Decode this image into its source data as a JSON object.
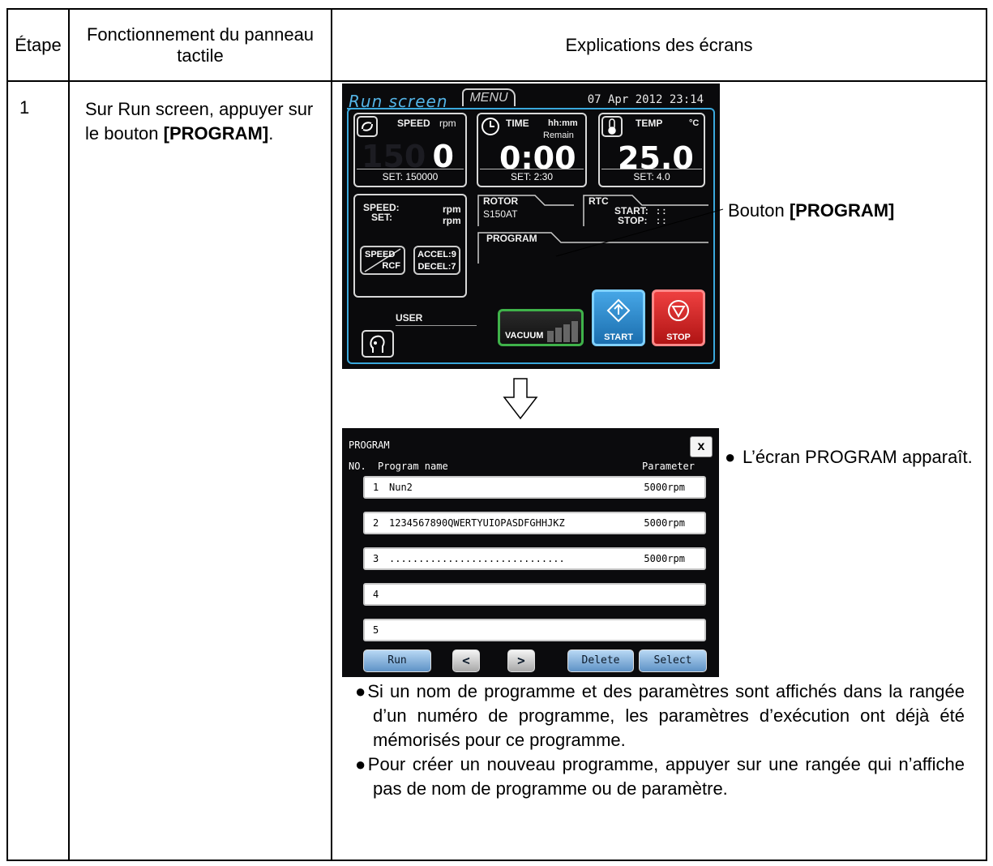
{
  "table": {
    "col_step": "Étape",
    "col_operation": "Fonctionnement du panneau tactile",
    "col_explanation": "Explications des écrans"
  },
  "row": {
    "step": "1",
    "operation_prefix": "Sur Run screen, appuyer sur le bouton ",
    "operation_button": "[PROGRAM]",
    "operation_suffix": "."
  },
  "run_screen": {
    "title": "Run screen",
    "menu_tab": "MENU",
    "datetime": "07 Apr 2012 23:14",
    "speed": {
      "label": "SPEED",
      "unit": "rpm",
      "value": "0",
      "set_label": "SET:",
      "set_value": "150000",
      "ghost_value": "150"
    },
    "time": {
      "label": "TIME",
      "unit": "hh:mm",
      "sub": "Remain",
      "value": "0:00",
      "set_label": "SET:",
      "set_value": "2:30"
    },
    "temp": {
      "label": "TEMP",
      "unit": "°C",
      "value": "25.0",
      "set_label": "SET:",
      "set_value": "4.0"
    },
    "speed2_label": "SPEED:",
    "speed2_unit": "rpm",
    "set2_label": "SET:",
    "set2_unit": "rpm",
    "rotor_label": "ROTOR",
    "rotor_value": "S150AT",
    "rtc_label": "RTC",
    "rtc_start": "START:",
    "rtc_stop": "STOP:",
    "rtc_start_value": ":   :",
    "rtc_stop_value": ":   :",
    "program_label": "PROGRAM",
    "speed_btn_top": "SPEED",
    "speed_btn_bottom": "RCF",
    "accel": "ACCEL:9",
    "decel": "DECEL:7",
    "user_label": "USER",
    "vacuum_label": "VACUUM",
    "start_label": "START",
    "stop_label": "STOP",
    "callout_prefix": "Bouton ",
    "callout_button": "[PROGRAM]"
  },
  "program_screen": {
    "title": "PROGRAM",
    "close": "x",
    "col_no": "NO.",
    "col_name": "Program name",
    "col_param": "Parameter",
    "rows": [
      {
        "no": "1",
        "name": "Nun2",
        "param": "5000rpm"
      },
      {
        "no": "2",
        "name": "1234567890QWERTYUIOPASDFGHHJKZ",
        "param": "5000rpm"
      },
      {
        "no": "3",
        "name": "..............................",
        "param": "5000rpm"
      },
      {
        "no": "4",
        "name": "",
        "param": ""
      },
      {
        "no": "5",
        "name": "",
        "param": ""
      }
    ],
    "buttons": {
      "run": "Run",
      "prev": "<",
      "next": ">",
      "delete": "Delete",
      "select": "Select"
    },
    "note": "L’écran PROGRAM apparaît."
  },
  "explanations": [
    "Si un nom de programme et des paramètres sont affichés dans la rangée d’un numéro de programme, les paramètres d’exécution ont déjà été mémorisés pour ce programme.",
    "Pour créer un nouveau programme, appuyer sur une rangée qui n’affiche pas de nom de programme ou de paramètre."
  ],
  "colors": {
    "accent_blue": "#3aa8dc",
    "start_blue": "#2f8fd0",
    "stop_red": "#d42a2a",
    "vacuum_green": "#3fb24a"
  }
}
